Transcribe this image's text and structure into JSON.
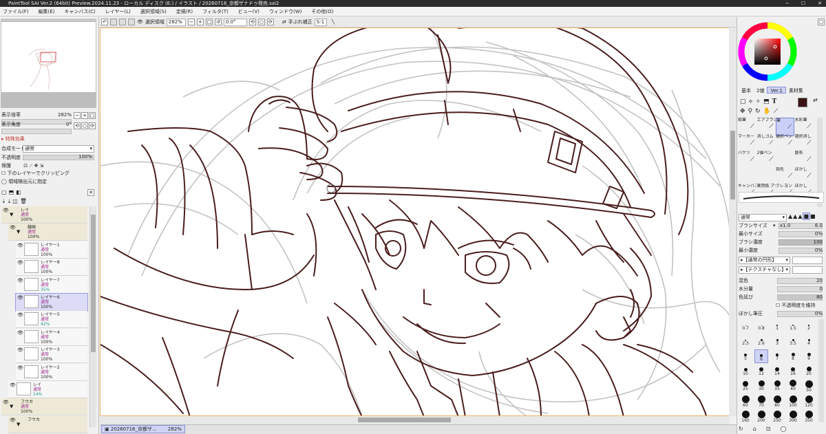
{
  "window": {
    "title": "PaintTool SAI Ver.2 (64bit) Preview.2024.11.23 - ローカル ディスク (E:) / イラスト / 20260716_京都ザナドゥ発売.sai2"
  },
  "menu": [
    "ファイル(F)",
    "編集(E)",
    "キャンバス(C)",
    "レイヤー(L)",
    "選択領域(S)",
    "定規(R)",
    "フィルタ(T)",
    "ビュー(V)",
    "ウィンドウ(W)",
    "その他(O)"
  ],
  "toolbar": {
    "selection_label": "選択領域",
    "zoom": "282%",
    "rotation": "0.0°",
    "stabilizer_label": "手ぶれ補正",
    "stabilizer_value": "S-1"
  },
  "navigator": {
    "zoom_label": "表示倍率",
    "zoom_value": "282%",
    "angle_label": "表示角度",
    "angle_value": "0°"
  },
  "layer_props": {
    "section": "特殊効果",
    "blend_label": "合成モード",
    "blend_value": "通常",
    "opacity_label": "不透明度",
    "opacity_value": "100%",
    "protect_label": "保護",
    "clip_label": "下のレイヤーでクリッピング",
    "select_src_label": "領域検出元に指定"
  },
  "layers": [
    {
      "name": "レイ",
      "mode": "通常",
      "opacity": "100%",
      "type": "folder",
      "indent": 0
    },
    {
      "name": "線画",
      "mode": "通常",
      "opacity": "100%",
      "type": "folder",
      "indent": 1
    },
    {
      "name": "レイヤー1",
      "mode": "通常",
      "opacity": "100%",
      "type": "layer",
      "indent": 2
    },
    {
      "name": "レイヤー8",
      "mode": "通常",
      "opacity": "100%",
      "type": "layer",
      "indent": 2
    },
    {
      "name": "レイヤー7",
      "mode": "通常",
      "opacity": "35%",
      "type": "layer",
      "indent": 2
    },
    {
      "name": "レイヤー6",
      "mode": "通常",
      "opacity": "100%",
      "type": "layer",
      "indent": 2,
      "selected": true
    },
    {
      "name": "レイヤー5",
      "mode": "通常",
      "opacity": "42%",
      "type": "layer",
      "indent": 2
    },
    {
      "name": "レイヤー4",
      "mode": "通常",
      "opacity": "100%",
      "type": "layer",
      "indent": 2
    },
    {
      "name": "レイヤー3",
      "mode": "通常",
      "opacity": "100%",
      "type": "layer",
      "indent": 2
    },
    {
      "name": "レイヤー2",
      "mode": "通常",
      "opacity": "100%",
      "type": "layer",
      "indent": 2
    },
    {
      "name": "レイ",
      "mode": "通常",
      "opacity": "14%",
      "type": "layer",
      "indent": 1
    },
    {
      "name": "フウカ",
      "mode": "通常",
      "opacity": "100%",
      "type": "folder",
      "indent": 0
    },
    {
      "name": "フウカ",
      "mode": "",
      "opacity": "",
      "type": "folder",
      "indent": 1
    }
  ],
  "status": {
    "document": "20260716_京都ザ...",
    "zoom": "282%"
  },
  "color_tabs": [
    "基本",
    "2値",
    "Ver.1",
    "素材集"
  ],
  "colors": {
    "primary": "#3a1414",
    "secondary": "#ffffff",
    "accent": "#cfd4f5",
    "line": "#4a1c1c"
  },
  "tools": [
    {
      "label": "鉛筆",
      "icon": "pencil-icon"
    },
    {
      "label": "エアブラシ",
      "icon": "airbrush-icon"
    },
    {
      "label": "筆",
      "icon": "brush-icon",
      "active": true
    },
    {
      "label": "水彩筆",
      "icon": "watercolor-icon"
    },
    {
      "label": "マーカー",
      "icon": "marker-icon"
    },
    {
      "label": "消しゴム",
      "icon": "eraser-icon"
    },
    {
      "label": "選択ペン",
      "icon": "select-pen-icon"
    },
    {
      "label": "選択消し",
      "icon": "select-erase-icon"
    },
    {
      "label": "バケツ",
      "icon": "bucket-icon"
    },
    {
      "label": "2値ペン",
      "icon": "binary-pen-icon"
    },
    {
      "label": "",
      "icon": "blank-icon"
    },
    {
      "label": "散布",
      "icon": "scatter-icon"
    },
    {
      "label": "",
      "icon": "blank-icon"
    },
    {
      "label": "",
      "icon": "blank-icon"
    },
    {
      "label": "指先",
      "icon": "finger-icon"
    },
    {
      "label": "ぼかし",
      "icon": "blur-icon"
    },
    {
      "label": "キャンバス アクリル",
      "icon": "acrylic-icon"
    },
    {
      "label": "薬用紙 アクリル",
      "icon": "paper-acrylic-icon"
    },
    {
      "label": "クレヨン",
      "icon": "crayon-icon"
    },
    {
      "label": "ぼかし",
      "icon": "blur2-icon"
    }
  ],
  "brush": {
    "mode": "通常",
    "size_label": "ブラシサイズ",
    "size_mult": "x1.0",
    "size_value": "6.0",
    "min_size_label": "最小サイズ",
    "min_size_value": "0%",
    "density_label": "ブラシ濃度",
    "density_value": "100",
    "min_density_label": "最小濃度",
    "min_density_value": "0%",
    "shape": "【通常の円形】",
    "texture": "【テクスチャなし】",
    "blend_label": "混色",
    "blend_value": "20",
    "water_label": "水分量",
    "water_value": "0",
    "persist_label": "色延び",
    "persist_value": "80",
    "keep_opacity_label": "不透明度を維持",
    "blur_label": "ぼかし筆圧",
    "blur_value": "0%"
  },
  "brush_sizes": [
    "0.7",
    "0.8",
    "1",
    "1.5",
    "2",
    "2.3",
    "2.6",
    "3",
    "3.5",
    "4",
    "5",
    "6",
    "7",
    "8",
    "9",
    "10",
    "12",
    "14",
    "16",
    "20",
    "25",
    "30",
    "35",
    "40",
    "50",
    "60",
    "70",
    "80",
    "100",
    "120",
    "160",
    "200",
    "250",
    "300",
    "350"
  ]
}
